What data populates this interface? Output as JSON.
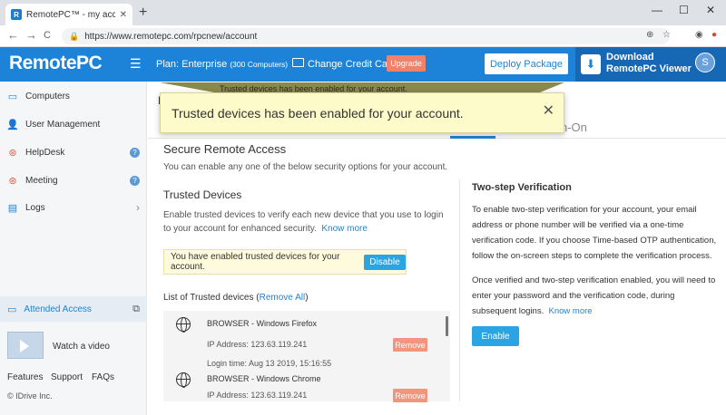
{
  "browser": {
    "tab_title": "RemotePC™ - my account informa",
    "favicon_letter": "R",
    "tab_close": "✕",
    "new_tab": "+",
    "url": "https://www.remotepc.com/rpcnew/account",
    "win_minimize": "—",
    "win_maximize": "☐",
    "win_close": "✕",
    "back": "←",
    "forward": "→",
    "reload": "C"
  },
  "header": {
    "logo": "RemotePC",
    "plan_label": "Plan: Enterprise",
    "plan_detail": "(300 Computers)",
    "change_card": "Change Credit Card",
    "upgrade": "Upgrade",
    "deploy": "Deploy Package",
    "download_line1": "Download",
    "download_line2": "RemotePC Viewer",
    "avatar": "S"
  },
  "sidebar": {
    "items": [
      {
        "label": "Computers",
        "badge": ""
      },
      {
        "label": "User Management",
        "badge": ""
      },
      {
        "label": "HelpDesk",
        "badge": "?"
      },
      {
        "label": "Meeting",
        "badge": "?"
      },
      {
        "label": "Logs",
        "badge": "›"
      }
    ],
    "attended": "Attended Access",
    "watch_video": "Watch a video",
    "footer_links": [
      "Features",
      "Support",
      "FAQs"
    ],
    "copyright": "© IDrive Inc."
  },
  "main": {
    "tab_sso": "n-On",
    "section_title": "Secure Remote Access",
    "section_desc": "You can enable any one of the below security options for your account.",
    "trusted_title": "Trusted Devices",
    "trusted_desc": "Enable trusted devices to verify each new device that you use to login to your account for enhanced security.",
    "know_more": "Know more",
    "enabled_text": "You have enabled trusted devices for your account.",
    "disable": "Disable",
    "list_title": "List of Trusted devices (",
    "remove_all": "Remove All",
    "list_title_end": ")",
    "devices": [
      {
        "name": "BROWSER - Windows Firefox",
        "ip": "IP Address: 123.63.119.241",
        "login": "Login time: Aug 13 2019, 15:16:55",
        "remove": "Remove"
      },
      {
        "name": "BROWSER - Windows Chrome",
        "ip": "IP Address: 123.63.119.241",
        "login": "",
        "remove": "Remove"
      }
    ],
    "tsv_title": "Two-step Verification",
    "tsv_p1": "To enable two-step verification for your account, your email address or phone number will be verified via a one-time verification code. If you choose Time-based OTP authentication, follow the on-screen steps to complete the verification process.",
    "tsv_p2": "Once verified and two-step verification enabled, you will need to enter your password and the verification code, during subsequent logins.",
    "tsv_know_more": "Know more",
    "enable": "Enable"
  },
  "toast": {
    "bar_text": "Trusted devices has been enabled for your account.",
    "message": "Trusted devices has been enabled for your account.",
    "close": "✕"
  },
  "colors": {
    "brand": "#1c83d8",
    "toast_bg": "#fdfbc9",
    "button": "#2aa4e2",
    "remove": "#f2957f"
  }
}
